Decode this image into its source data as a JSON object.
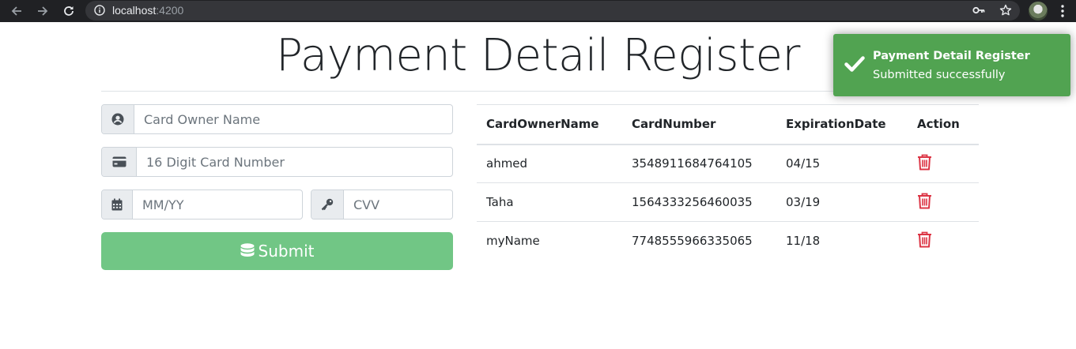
{
  "browser": {
    "url_host": "localhost",
    "url_port": ":4200"
  },
  "page": {
    "title": "Payment Detail Register"
  },
  "form": {
    "owner_name": {
      "placeholder": "Card Owner Name",
      "value": ""
    },
    "card_number": {
      "placeholder": "16 Digit Card Number",
      "value": ""
    },
    "expiration": {
      "placeholder": "MM/YY",
      "value": ""
    },
    "cvv": {
      "placeholder": "CVV",
      "value": ""
    },
    "submit_label": "Submit"
  },
  "table": {
    "headers": [
      "CardOwnerName",
      "CardNumber",
      "ExpirationDate",
      "Action"
    ],
    "rows": [
      {
        "owner": "ahmed",
        "number": "3548911684764105",
        "expiration": "04/15"
      },
      {
        "owner": "Taha",
        "number": "1564333256460035",
        "expiration": "03/19"
      },
      {
        "owner": "myName",
        "number": "7748555966335065",
        "expiration": "11/18"
      }
    ]
  },
  "toast": {
    "title": "Payment Detail Register",
    "message": "Submitted successfully"
  },
  "colors": {
    "success": "#51a351",
    "submit": "#71c685",
    "danger": "#dc3545"
  },
  "icons": [
    "back-arrow-icon",
    "forward-arrow-icon",
    "reload-icon",
    "info-icon",
    "key-icon",
    "star-icon",
    "user-circle-icon",
    "credit-card-icon",
    "calendar-icon",
    "database-icon",
    "trash-icon",
    "checkmark-icon"
  ]
}
